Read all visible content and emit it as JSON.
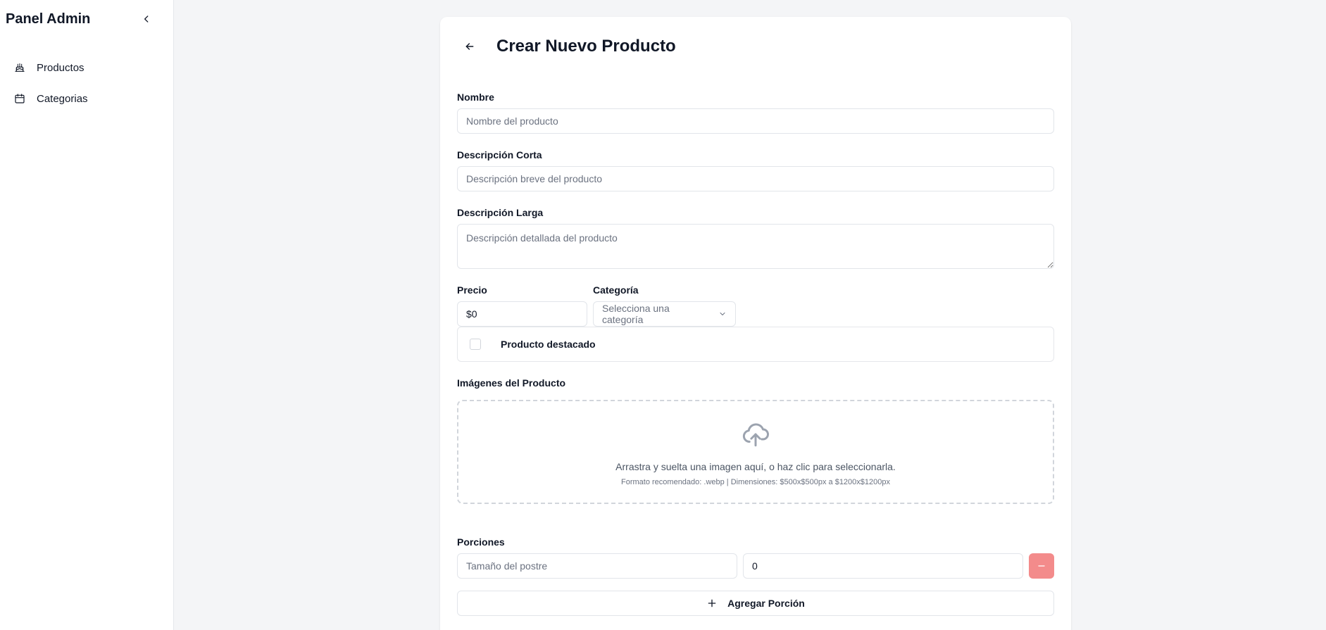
{
  "sidebar": {
    "brand": "Panel Admin",
    "collapse_icon": "chevron-left-icon",
    "items": [
      {
        "label": "Productos",
        "icon": "cake-icon"
      },
      {
        "label": "Categorias",
        "icon": "calendar-icon"
      }
    ]
  },
  "form": {
    "title": "Crear Nuevo Producto",
    "back_icon": "arrow-left-icon",
    "name": {
      "label": "Nombre",
      "placeholder": "Nombre del producto",
      "value": ""
    },
    "short_desc": {
      "label": "Descripción Corta",
      "placeholder": "Descripción breve del producto",
      "value": ""
    },
    "long_desc": {
      "label": "Descripción Larga",
      "placeholder": "Descripción detallada del producto",
      "value": ""
    },
    "price": {
      "label": "Precio",
      "value": "$0"
    },
    "category": {
      "label": "Categoría",
      "selected": "Selecciona una categoría"
    },
    "featured": {
      "label": "Producto destacado",
      "checked": false
    },
    "images": {
      "label": "Imágenes del Producto",
      "drop_text": "Arrastra y suelta una imagen aquí, o haz clic para seleccionarla.",
      "format_text": "Formato recomendado: .webp | Dimensiones: $500x$500px a $1200x$1200px"
    },
    "portions": {
      "label": "Porciones",
      "size_placeholder": "Tamaño del postre",
      "size_value": "",
      "qty_value": "0",
      "add_label": "Agregar Porción"
    }
  },
  "colors": {
    "background": "#f4f5f7",
    "remove_button": "#f38b8b",
    "border": "#e2e5ea"
  }
}
